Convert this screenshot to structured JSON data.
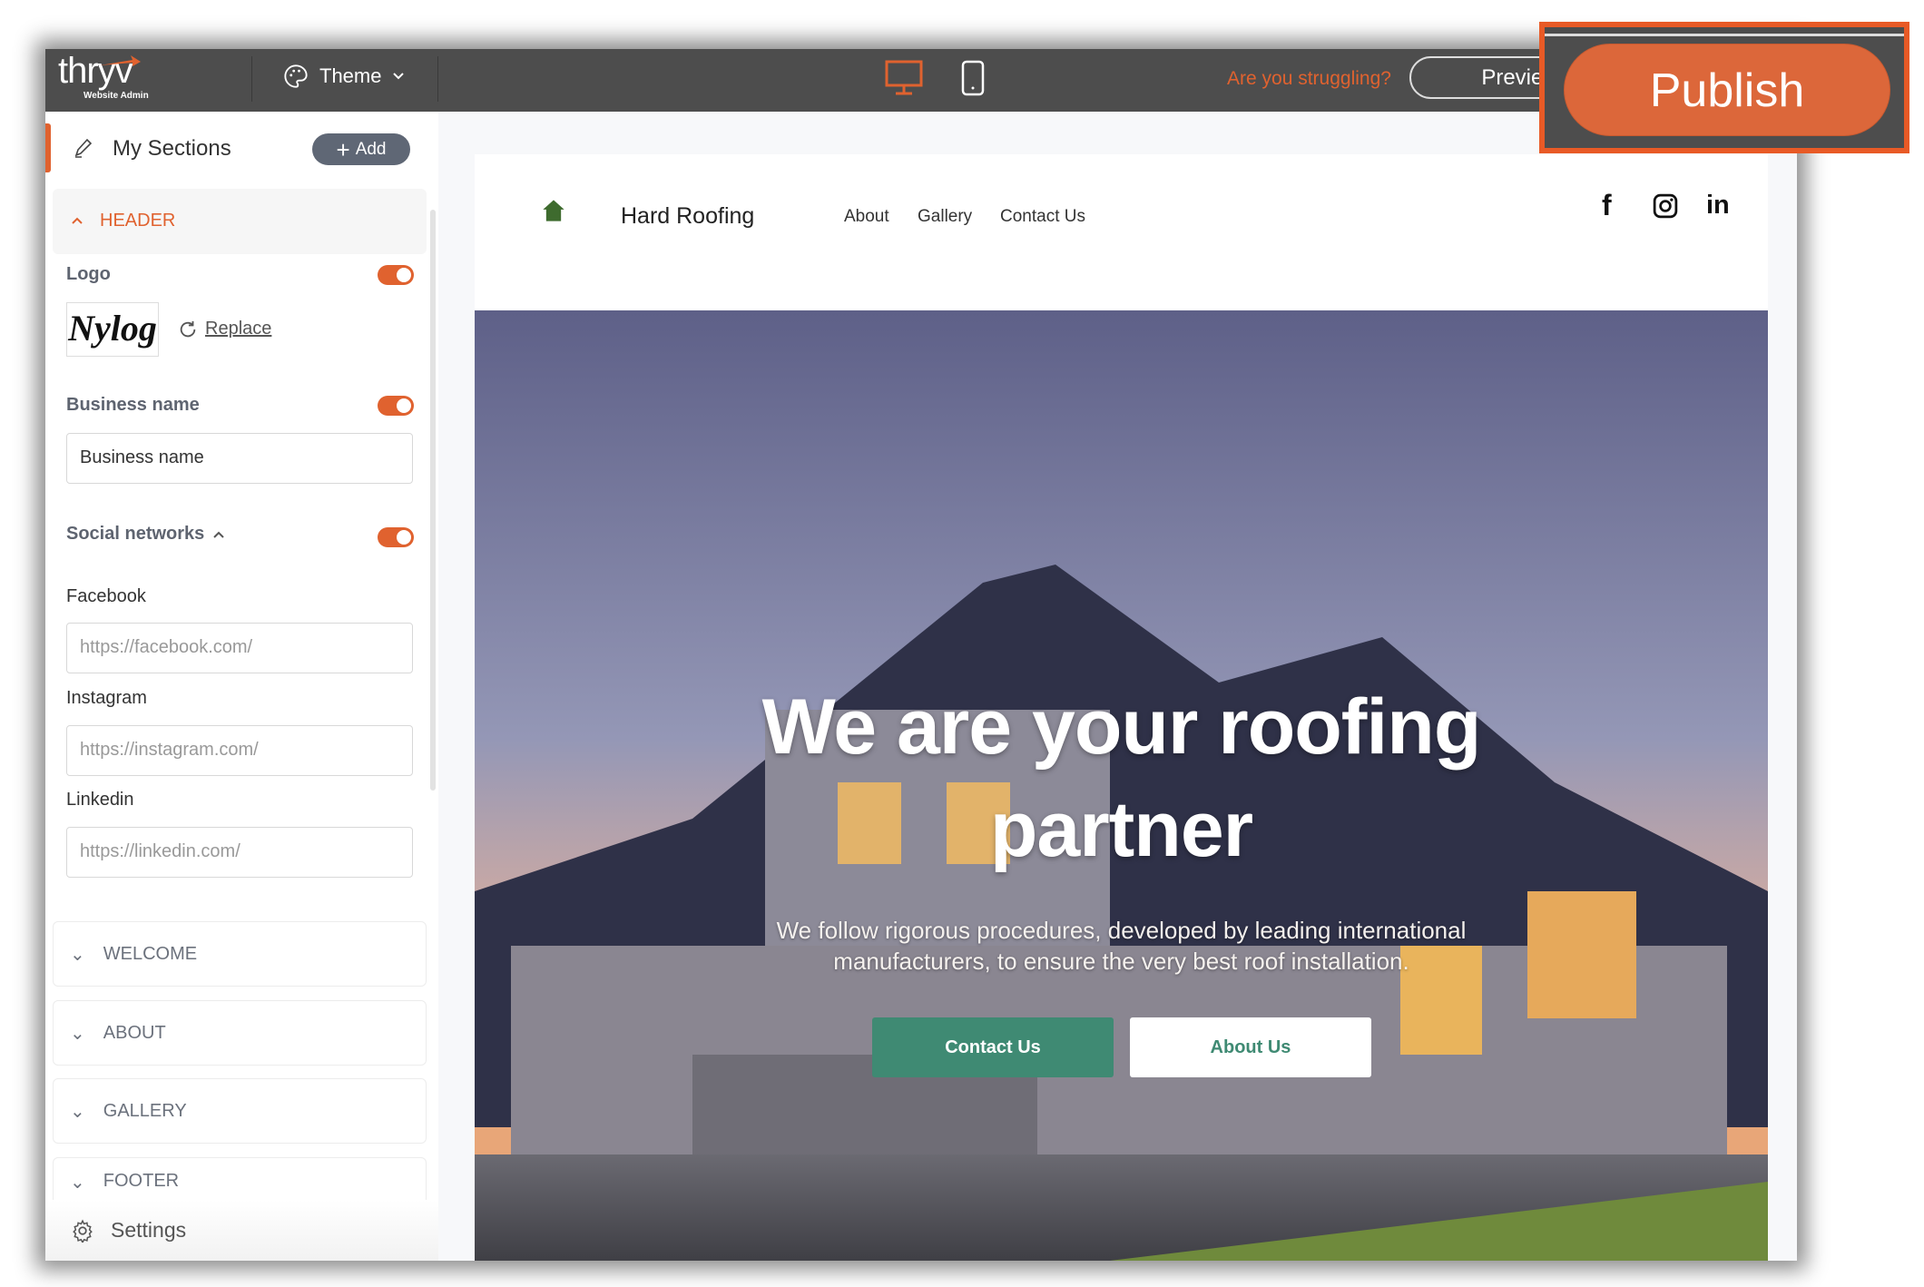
{
  "topbar": {
    "logo_text": "thryv",
    "logo_subtitle": "Website Admin",
    "theme_label": "Theme",
    "device_icons": [
      "desktop-icon",
      "mobile-icon"
    ],
    "active_device": "desktop",
    "help_link": "Are you struggling?",
    "preview_label": "Preview",
    "publish_label": "Publish"
  },
  "sidebar": {
    "title": "My Sections",
    "add_label": "Add",
    "header_section": {
      "title": "HEADER",
      "logo_label": "Logo",
      "logo_enabled": true,
      "logo_image_text": "Nylog",
      "replace_label": "Replace",
      "business_name_label": "Business name",
      "business_name_enabled": true,
      "business_name_value": "Business name",
      "social_label": "Social networks",
      "social_enabled": true,
      "facebook_label": "Facebook",
      "facebook_placeholder": "https://facebook.com/",
      "instagram_label": "Instagram",
      "instagram_placeholder": "https://instagram.com/",
      "linkedin_label": "Linkedin",
      "linkedin_placeholder": "https://linkedin.com/"
    },
    "sections": [
      {
        "label": "WELCOME"
      },
      {
        "label": "ABOUT"
      },
      {
        "label": "GALLERY"
      },
      {
        "label": "FOOTER"
      }
    ],
    "settings_label": "Settings"
  },
  "site": {
    "business_name": "Hard Roofing",
    "nav": [
      "About",
      "Gallery",
      "Contact Us"
    ],
    "social_icons": [
      "facebook-icon",
      "instagram-icon",
      "linkedin-icon"
    ],
    "hero_title_line1": "We are your roofing",
    "hero_title_line2": "partner",
    "hero_subtitle_line1": "We follow rigorous procedures, developed by leading international",
    "hero_subtitle_line2": "manufacturers, to ensure the very best roof installation.",
    "primary_button": "Contact Us",
    "secondary_button": "About Us"
  },
  "colors": {
    "accent": "#e0622f",
    "topbar": "#4d4d4d",
    "site_green": "#3f8a73",
    "add_button": "#5f6775"
  }
}
